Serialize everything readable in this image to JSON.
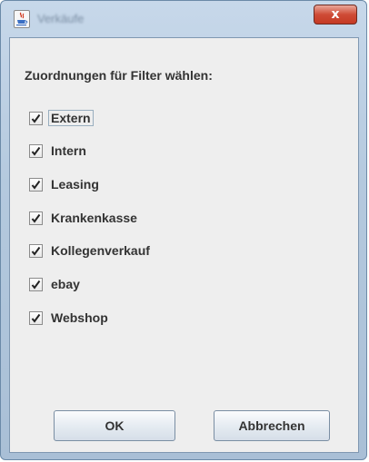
{
  "window": {
    "title": "Verkäufe",
    "close_glyph": "x"
  },
  "dialog": {
    "heading": "Zuordnungen für Filter wählen:",
    "options": [
      {
        "label": "Extern",
        "checked": true
      },
      {
        "label": "Intern",
        "checked": true
      },
      {
        "label": "Leasing",
        "checked": true
      },
      {
        "label": "Krankenkasse",
        "checked": true
      },
      {
        "label": "Kollegenverkauf",
        "checked": true
      },
      {
        "label": "ebay",
        "checked": true
      },
      {
        "label": "Webshop",
        "checked": true
      }
    ],
    "ok_label": "OK",
    "cancel_label": "Abbrechen"
  },
  "icons": {
    "app": "java-coffee-icon",
    "close": "close-icon",
    "check": "checkmark-icon"
  }
}
